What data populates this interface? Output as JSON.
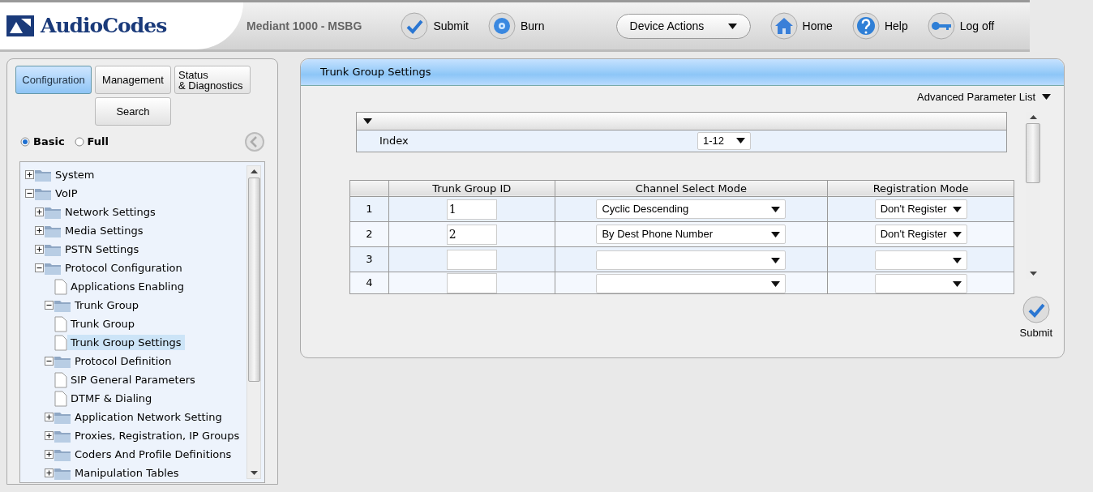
{
  "header": {
    "brand": "AudioCodes",
    "device": "Mediant 1000 - MSBG",
    "actions": [
      {
        "kind": "submit",
        "label": "Submit"
      },
      {
        "kind": "burn",
        "label": "Burn"
      }
    ],
    "device_actions": "Device Actions",
    "links": [
      {
        "kind": "home",
        "label": "Home"
      },
      {
        "kind": "help",
        "label": "Help"
      },
      {
        "kind": "logoff",
        "label": "Log off"
      }
    ]
  },
  "nav_tabs": [
    {
      "label": "Configuration",
      "selected": true
    },
    {
      "label": "Management",
      "selected": false
    },
    {
      "label": "Status\n& Diagnostics",
      "selected": false
    },
    {
      "label": "Search",
      "selected": false
    }
  ],
  "view_modes": [
    {
      "label": "Basic",
      "selected": true
    },
    {
      "label": "Full",
      "selected": false
    }
  ],
  "tree": [
    {
      "label": "System",
      "kind": "folder",
      "expanded": false,
      "selected": false
    },
    {
      "label": "VoIP",
      "kind": "folder",
      "expanded": true,
      "selected": false,
      "children": [
        {
          "label": "Network Settings",
          "kind": "folder",
          "expanded": false,
          "selected": false
        },
        {
          "label": "Media Settings",
          "kind": "folder",
          "expanded": false,
          "selected": false
        },
        {
          "label": "PSTN Settings",
          "kind": "folder",
          "expanded": false,
          "selected": false
        },
        {
          "label": "Protocol Configuration",
          "kind": "folder",
          "expanded": true,
          "selected": false,
          "children": [
            {
              "label": "Applications Enabling",
              "kind": "page",
              "selected": false
            },
            {
              "label": "Trunk Group",
              "kind": "folder",
              "expanded": true,
              "selected": false,
              "children": [
                {
                  "label": "Trunk Group",
                  "kind": "page",
                  "selected": false
                },
                {
                  "label": "Trunk Group Settings",
                  "kind": "page",
                  "selected": true
                }
              ]
            },
            {
              "label": "Protocol Definition",
              "kind": "folder",
              "expanded": true,
              "selected": false,
              "children": [
                {
                  "label": "SIP General Parameters",
                  "kind": "page",
                  "selected": false
                },
                {
                  "label": "DTMF & Dialing",
                  "kind": "page",
                  "selected": false
                }
              ]
            },
            {
              "label": "Application Network Setting",
              "kind": "folder",
              "expanded": false,
              "selected": false
            },
            {
              "label": "Proxies, Registration, IP Groups",
              "kind": "folder",
              "expanded": false,
              "selected": false
            },
            {
              "label": "Coders And Profile Definitions",
              "kind": "folder",
              "expanded": false,
              "selected": false
            },
            {
              "label": "Manipulation Tables",
              "kind": "folder",
              "expanded": false,
              "selected": false
            }
          ]
        }
      ]
    }
  ],
  "page": {
    "title": "Trunk Group Settings",
    "advanced": "Advanced Parameter List",
    "index_label": "Index",
    "index_value": "1-12",
    "table": {
      "columns": [
        "Trunk Group ID",
        "Channel Select Mode",
        "Registration Mode"
      ],
      "rows": [
        {
          "num": "1",
          "id": "1",
          "channel_mode": "Cyclic Descending",
          "registration_mode": "Don't Register"
        },
        {
          "num": "2",
          "id": "2",
          "channel_mode": "By Dest Phone Number",
          "registration_mode": "Don't Register"
        },
        {
          "num": "3",
          "id": "",
          "channel_mode": "",
          "registration_mode": ""
        },
        {
          "num": "4",
          "id": "",
          "channel_mode": "",
          "registration_mode": ""
        }
      ]
    },
    "submit": "Submit"
  }
}
